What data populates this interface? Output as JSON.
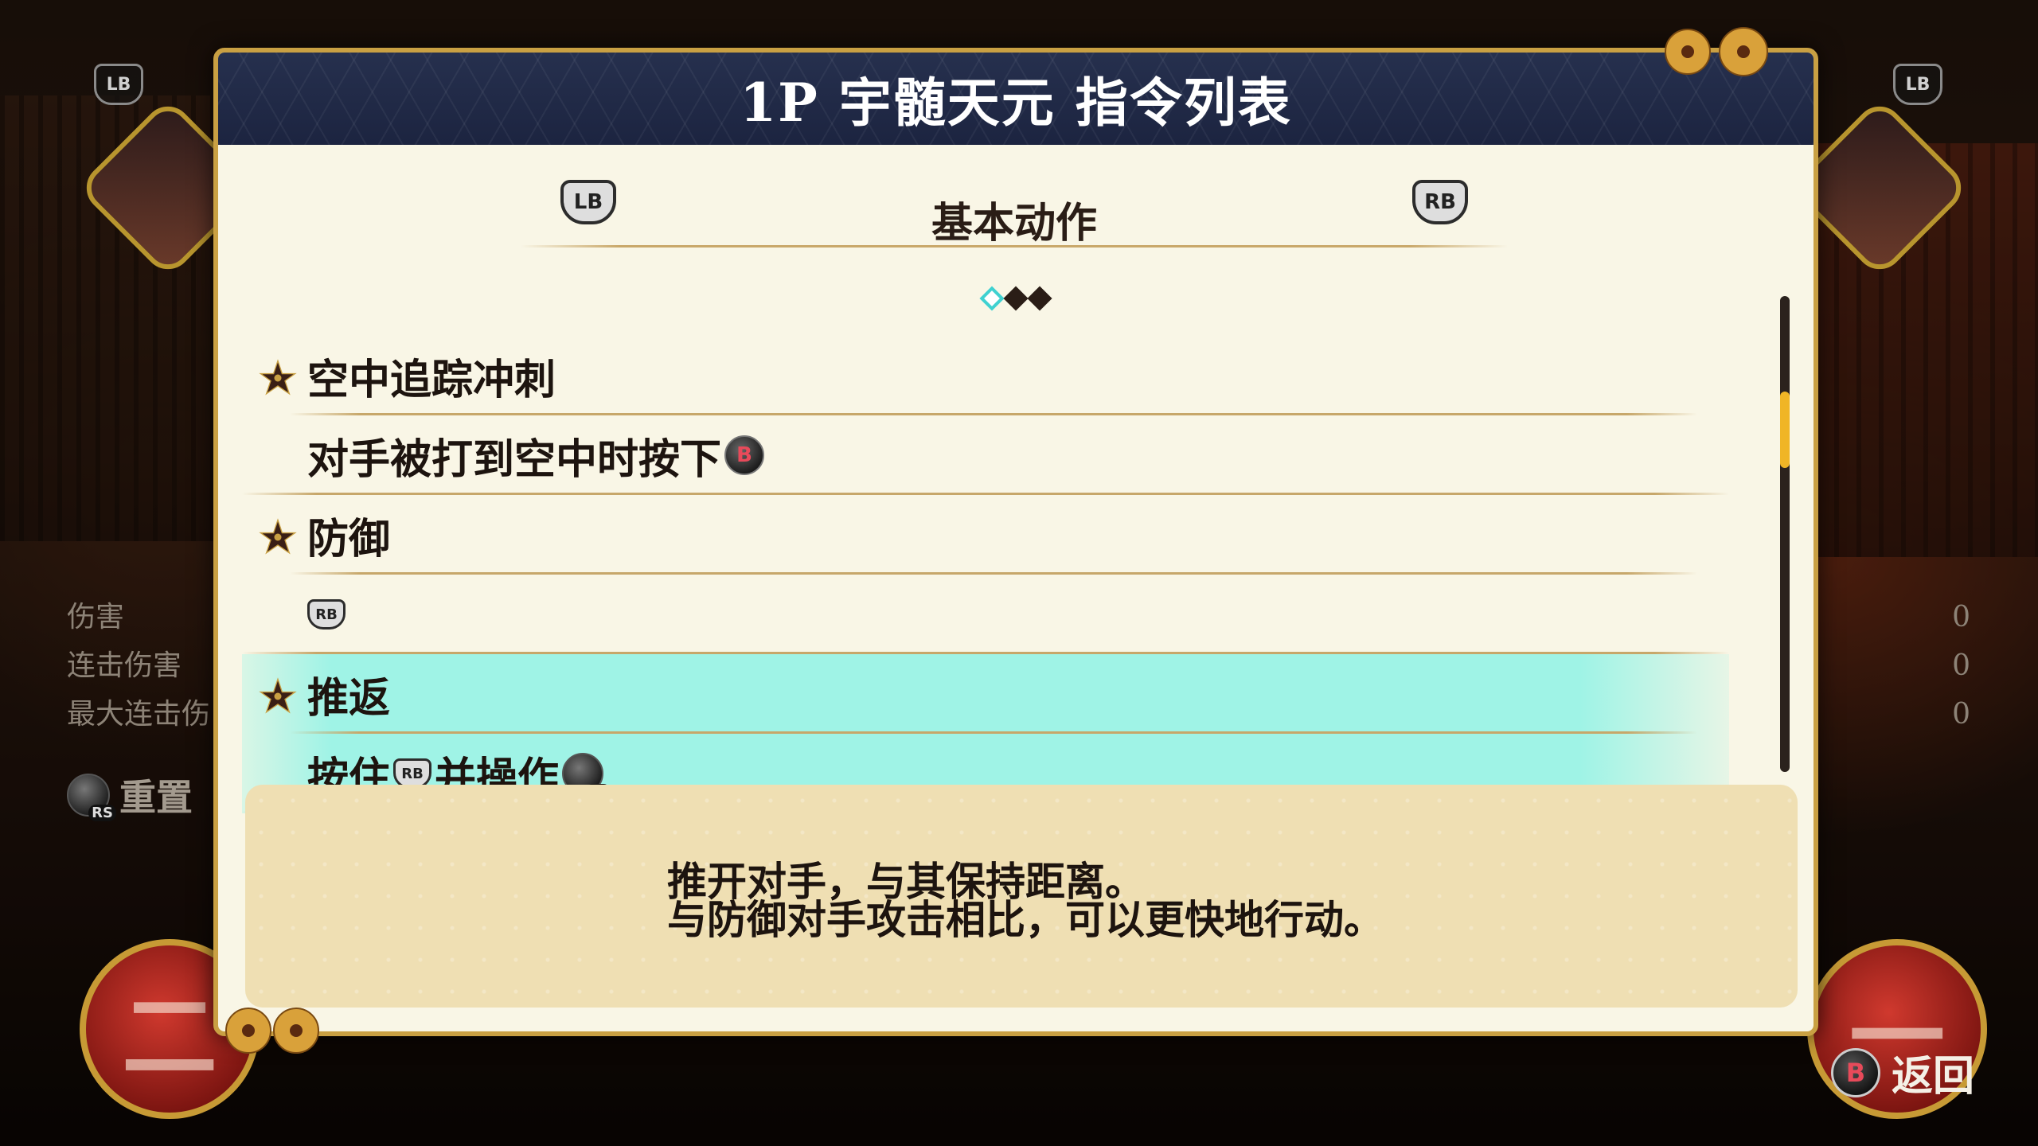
{
  "panel": {
    "title": "1P 宇髄天元 指令列表"
  },
  "tabs": {
    "left_button": "LB",
    "right_button": "RB",
    "current_label": "基本动作",
    "page_count": 3,
    "active_page": 1
  },
  "commands": [
    {
      "name": "空中追踪冲刺",
      "input_text": "对手被打到空中时按下",
      "input_buttons": [
        "B"
      ],
      "selected": false
    },
    {
      "name": "防御",
      "input_text": "",
      "input_buttons": [
        "RB"
      ],
      "selected": false
    },
    {
      "name": "推返",
      "input_prefix": "按住",
      "input_mid": "并操作",
      "input_buttons": [
        "RB",
        "LS"
      ],
      "selected": true
    }
  ],
  "scrollbar": {
    "position_fraction": 0.24
  },
  "description": {
    "line1": "推开对手，与其保持距离。",
    "line2": "与防御对手攻击相比，可以更快地行动。"
  },
  "hud": {
    "left_stats": [
      "伤害",
      "连击伤害",
      "最大连击伤"
    ],
    "right_values": [
      "0",
      "0",
      "0"
    ],
    "reset_label": "重置",
    "reset_button": "RS",
    "left_seal": "二",
    "right_seal": "一",
    "top_left_button": "LB",
    "top_right_button": "LB",
    "back_button": "B",
    "back_label": "返回"
  },
  "colors": {
    "header_navy": "#1f2845",
    "gold_border": "#c9a043",
    "highlight_cyan": "#9ff3e6",
    "description_bg": "#efdfb3",
    "scroll_thumb": "#f0b526"
  }
}
